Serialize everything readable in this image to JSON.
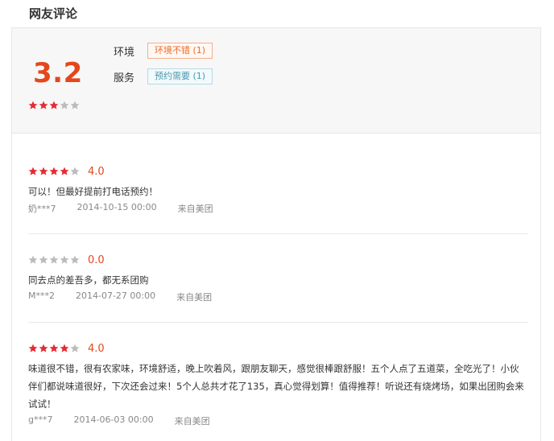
{
  "section_title": "网友评论",
  "summary": {
    "score": "3.2",
    "stars": 3,
    "tags": [
      {
        "label": "环境",
        "tag": "环境不错 (1)"
      },
      {
        "label": "服务",
        "tag": "预约需要 (1)"
      }
    ]
  },
  "colors": {
    "accent": "#e5461c",
    "star_on": "#e62a32",
    "star_off": "#bbbbbb"
  },
  "reviews": [
    {
      "stars": 4,
      "rating": "4.0",
      "text": "可以！但最好提前打电话预约！",
      "user": "奶***7",
      "date": "2014-10-15 00:00",
      "source": "来自美团"
    },
    {
      "stars": 0,
      "rating": "0.0",
      "text": "同去点的差吾多，都无系团购",
      "user": "M***2",
      "date": "2014-07-27 00:00",
      "source": "来自美团"
    },
    {
      "stars": 4,
      "rating": "4.0",
      "text": "味道很不错，很有农家味，环境舒适，晚上吹着风，跟朋友聊天，感觉很棒跟舒服！五个人点了五道菜，全吃光了！小伙伴们都说味道很好，下次还会过来！5个人总共才花了135，真心觉得划算！值得推荐！听说还有烧烤场，如果出团购会来试试！",
      "user": "g***7",
      "date": "2014-06-03 00:00",
      "source": "来自美团"
    }
  ]
}
